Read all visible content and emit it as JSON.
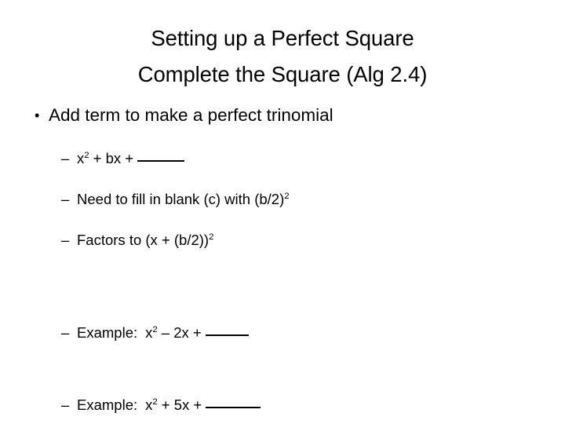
{
  "slide": {
    "background_color": "#ffffff",
    "text_color": "#000000",
    "title": {
      "line1": "Setting up a Perfect Square",
      "line2": "Complete the Square (Alg 2.4)"
    },
    "bullets": {
      "level1": {
        "marker": "•",
        "text": "Add term to make a perfect trinomial"
      },
      "level2_marker": "–",
      "items": [
        {
          "id": "formula-general",
          "parts": {
            "base": "x",
            "exp": "2",
            "rest": "+ bx +",
            "blank": "_____"
          }
        },
        {
          "id": "need-to-fill",
          "parts": {
            "pre": "Need to fill in blank (c) with (b/2)",
            "exp": "2"
          }
        },
        {
          "id": "factors-to",
          "parts": {
            "pre": "Factors to (x + (b/2))",
            "exp": "2"
          }
        },
        {
          "id": "example-1",
          "parts": {
            "label": "Example:",
            "base": "x",
            "exp": "2",
            "rest": "– 2x +",
            "blank": "____"
          }
        },
        {
          "id": "example-2",
          "parts": {
            "label": "Example:",
            "base": "x",
            "exp": "2",
            "rest": "+ 5x +",
            "blank": "______"
          }
        }
      ]
    }
  }
}
